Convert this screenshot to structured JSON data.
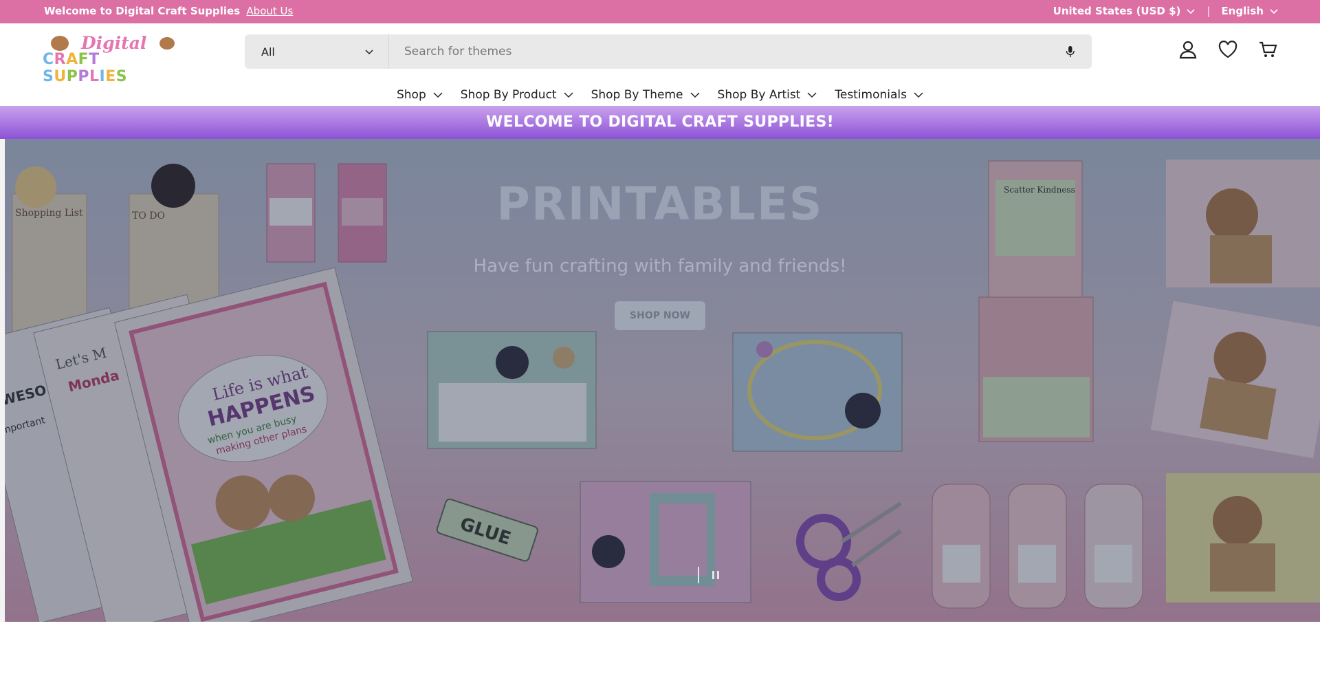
{
  "topbar": {
    "welcome_text": "Welcome to Digital Craft Supplies",
    "about_link": "About Us",
    "currency": "United States (USD $)",
    "separator": "|",
    "language": "English"
  },
  "logo": {
    "line1": "Digital",
    "line2": "CRAFT SUPPLIES"
  },
  "search": {
    "category_selected": "All",
    "placeholder": "Search for themes"
  },
  "header_icons": [
    "account-icon",
    "heart-icon",
    "cart-icon"
  ],
  "nav": [
    {
      "label": "Shop"
    },
    {
      "label": "Shop By Product"
    },
    {
      "label": "Shop By Theme"
    },
    {
      "label": "Shop By Artist"
    },
    {
      "label": "Testimonials"
    }
  ],
  "banner": {
    "text": "WELCOME TO DIGITAL CRAFT SUPPLIES!"
  },
  "hero": {
    "title": "PRINTABLES",
    "subtitle": "Have fun crafting with family and friends!",
    "button": "SHOP NOW",
    "artwork_text": {
      "shopping_list": "Shopping List",
      "to_do": "TO DO",
      "scatter_kindness": "Scatter Kindness",
      "life_is": "Life is what",
      "happens": "HAPPENS",
      "busy": "when you are busy",
      "plans": "making other plans",
      "glue": "GLUE",
      "lets": "Let's M",
      "monday": "Monda",
      "awesome": "AWESO",
      "important": "Important"
    }
  },
  "colors": {
    "topbar": "#dc6fa3",
    "banner": "#9a63dc",
    "logo_pink": "#e476b2"
  }
}
